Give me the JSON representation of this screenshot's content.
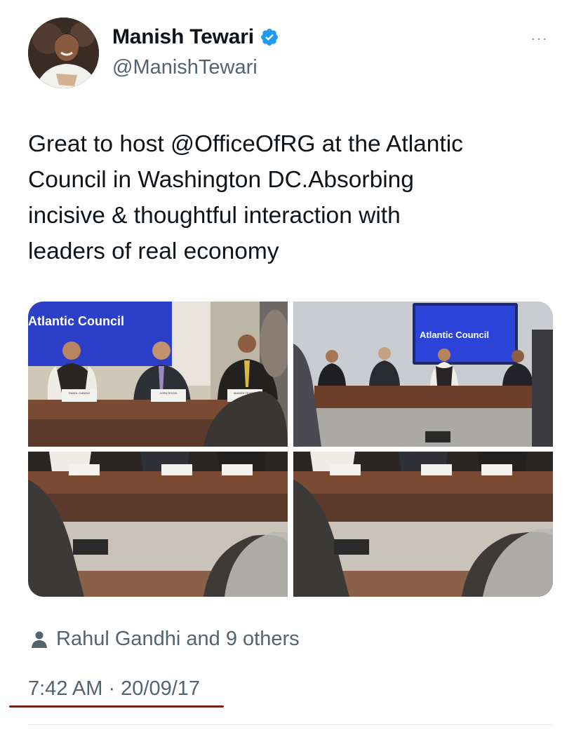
{
  "author": {
    "display_name": "Manish Tewari",
    "handle": "@ManishTewari",
    "verified": true
  },
  "more_menu": "···",
  "tweet": {
    "text_lines": [
      "Great to host @OfficeOfRG at the Atlantic",
      "Council in Washington DC.Absorbing",
      "incisive & thoughtful interaction with",
      "leaders of real economy"
    ]
  },
  "media": {
    "screen_label": "Atlantic Council",
    "name_cards": {
      "rahul": "RAHUL GANDHI",
      "josh": "JOSH ROGIN",
      "manish": "MANISH TEWARI"
    }
  },
  "social_context": {
    "icon": "person-icon",
    "text": "Rahul Gandhi and 9 others"
  },
  "meta": {
    "timestamp": "7:42 AM · 20/09/17"
  },
  "colors": {
    "verified_blue": "#1d9bf0",
    "secondary_text": "#536471",
    "underline": "#7a1f16",
    "screen_blue": "#2b3fc9"
  }
}
